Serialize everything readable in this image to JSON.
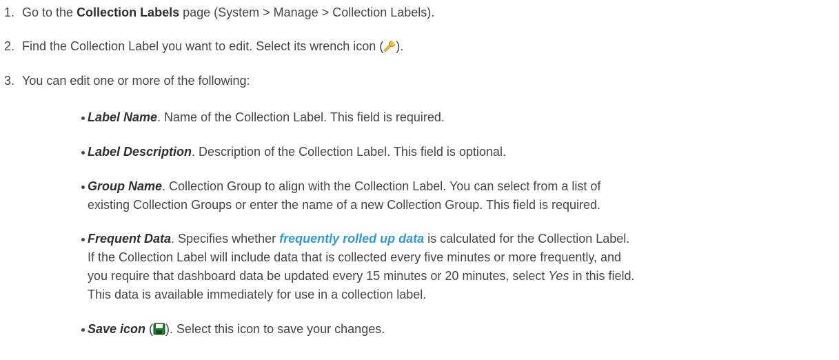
{
  "steps": [
    {
      "number": "1.",
      "prefix": "Go to the ",
      "bold": "Collection Labels",
      "suffix": " page (System > Manage > Collection Labels)."
    },
    {
      "number": "2.",
      "text_before": "Find the Collection Label you want to edit. Select its wrench icon (",
      "icon": "wrench-icon",
      "text_after": ")."
    },
    {
      "number": "3.",
      "text": "You can edit one or more of the following:"
    }
  ],
  "fields": [
    {
      "term": "Label Name",
      "line1": ". Name of the Collection Label. This field is required."
    },
    {
      "term": "Label Description",
      "line1": ". Description of the Collection Label. This field is optional."
    },
    {
      "term": "Group Name",
      "line1": ". Collection Group to align with the Collection Label. You can select from a list of",
      "line2": "existing Collection Groups or enter the name of a new Collection Group. This field is required."
    },
    {
      "term": "Frequent Data",
      "line1_a": ". Specifies whether ",
      "link": "frequently rolled up data",
      "line1_b": " is calculated for the Collection Label.",
      "line2": "If the Collection Label will include data that is collected every five minutes or more frequently, and",
      "line3_a": "you require that dashboard data be updated every 15 minutes or 20 minutes, select ",
      "line3_ital": "Yes",
      "line3_b": " in this field.",
      "line4": "This data is available immediately for use in a collection label."
    },
    {
      "term": "Save icon",
      "text_before": " (",
      "icon": "save-icon",
      "text_after": "). Select this icon to save your changes."
    }
  ],
  "colors": {
    "text": "#454545",
    "link": "#2f9ad6",
    "save_icon": "#1f7a2e",
    "wrench_icon": "#e3b21d"
  }
}
